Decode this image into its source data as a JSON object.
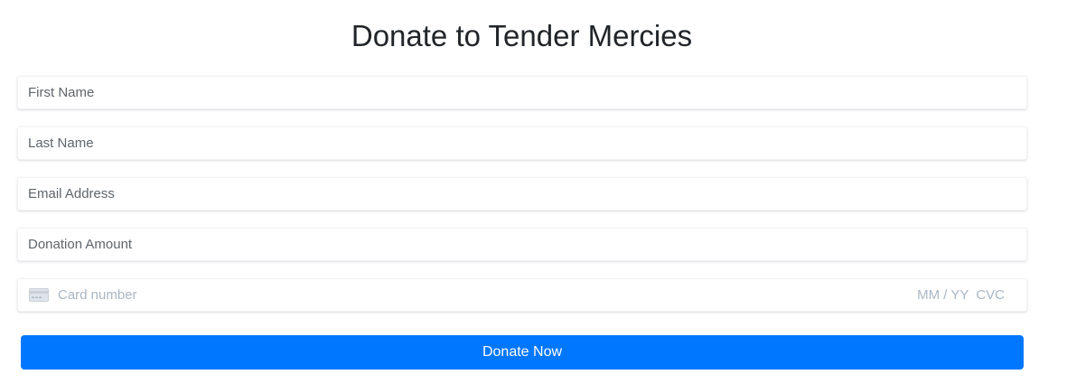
{
  "form": {
    "title": "Donate to Tender Mercies",
    "first_name_placeholder": "First Name",
    "last_name_placeholder": "Last Name",
    "email_placeholder": "Email Address",
    "amount_placeholder": "Donation Amount",
    "card": {
      "icon": "credit-card-icon",
      "number_placeholder": "Card number",
      "expiry_placeholder": "MM / YY",
      "cvc_placeholder": "CVC"
    },
    "submit_label": "Donate Now"
  },
  "colors": {
    "primary_button": "#0077ff",
    "placeholder": "#5f656b",
    "card_placeholder": "#aab7c4",
    "title": "#212529"
  }
}
